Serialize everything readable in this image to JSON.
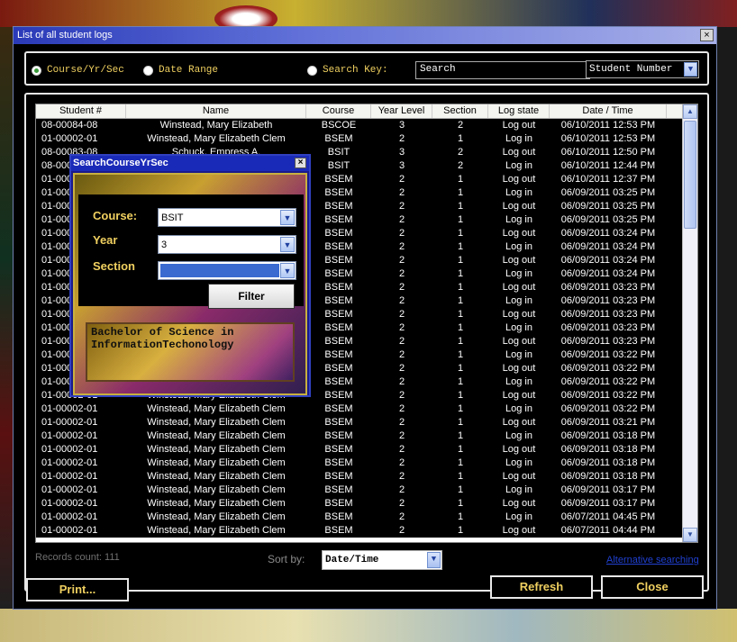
{
  "window": {
    "title": "List of all student logs",
    "close_glyph": "×"
  },
  "filter": {
    "radio_course": "Course/Yr/Sec",
    "radio_date": "Date Range",
    "radio_search": "Search Key:",
    "search_value": "Search",
    "search_field": "Student Number"
  },
  "grid": {
    "columns": [
      "Student #",
      "Name",
      "Course",
      "Year Level",
      "Section",
      "Log state",
      "Date / Time"
    ],
    "rows": [
      [
        "08-00084-08",
        "Winstead, Mary Elizabeth",
        "BSCOE",
        "3",
        "2",
        "Log out",
        "06/10/2011 12:53 PM"
      ],
      [
        "01-00002-01",
        "Winstead, Mary Elizabeth Clem",
        "BSEM",
        "2",
        "1",
        "Log in",
        "06/10/2011 12:53 PM"
      ],
      [
        "08-00083-08",
        "Schuck, Empress A.",
        "BSIT",
        "3",
        "2",
        "Log out",
        "06/10/2011 12:50 PM"
      ],
      [
        "08-00083-08",
        "Schuck, Empress A.",
        "BSIT",
        "3",
        "2",
        "Log in",
        "06/10/2011 12:44 PM"
      ],
      [
        "01-00002-01",
        "Winstead, Mary Elizabeth Clem",
        "BSEM",
        "2",
        "1",
        "Log out",
        "06/10/2011 12:37 PM"
      ],
      [
        "01-00002-01",
        "Winstead, Mary Elizabeth Clem",
        "BSEM",
        "2",
        "1",
        "Log in",
        "06/09/2011 03:25 PM"
      ],
      [
        "01-00002-01",
        "Winstead, Mary Elizabeth Clem",
        "BSEM",
        "2",
        "1",
        "Log out",
        "06/09/2011 03:25 PM"
      ],
      [
        "01-00002-01",
        "Winstead, Mary Elizabeth Clem",
        "BSEM",
        "2",
        "1",
        "Log in",
        "06/09/2011 03:25 PM"
      ],
      [
        "01-00002-01",
        "Winstead, Mary Elizabeth Clem",
        "BSEM",
        "2",
        "1",
        "Log out",
        "06/09/2011 03:24 PM"
      ],
      [
        "01-00002-01",
        "Winstead, Mary Elizabeth Clem",
        "BSEM",
        "2",
        "1",
        "Log in",
        "06/09/2011 03:24 PM"
      ],
      [
        "01-00002-01",
        "Winstead, Mary Elizabeth Clem",
        "BSEM",
        "2",
        "1",
        "Log out",
        "06/09/2011 03:24 PM"
      ],
      [
        "01-00002-01",
        "Winstead, Mary Elizabeth Clem",
        "BSEM",
        "2",
        "1",
        "Log in",
        "06/09/2011 03:24 PM"
      ],
      [
        "01-00002-01",
        "Winstead, Mary Elizabeth Clem",
        "BSEM",
        "2",
        "1",
        "Log out",
        "06/09/2011 03:23 PM"
      ],
      [
        "01-00002-01",
        "Winstead, Mary Elizabeth Clem",
        "BSEM",
        "2",
        "1",
        "Log in",
        "06/09/2011 03:23 PM"
      ],
      [
        "01-00002-01",
        "Winstead, Mary Elizabeth Clem",
        "BSEM",
        "2",
        "1",
        "Log out",
        "06/09/2011 03:23 PM"
      ],
      [
        "01-00002-01",
        "Winstead, Mary Elizabeth Clem",
        "BSEM",
        "2",
        "1",
        "Log in",
        "06/09/2011 03:23 PM"
      ],
      [
        "01-00002-01",
        "Winstead, Mary Elizabeth Clem",
        "BSEM",
        "2",
        "1",
        "Log out",
        "06/09/2011 03:23 PM"
      ],
      [
        "01-00002-01",
        "Winstead, Mary Elizabeth Clem",
        "BSEM",
        "2",
        "1",
        "Log in",
        "06/09/2011 03:22 PM"
      ],
      [
        "01-00002-01",
        "Winstead, Mary Elizabeth Clem",
        "BSEM",
        "2",
        "1",
        "Log out",
        "06/09/2011 03:22 PM"
      ],
      [
        "01-00002-01",
        "Winstead, Mary Elizabeth Clem",
        "BSEM",
        "2",
        "1",
        "Log in",
        "06/09/2011 03:22 PM"
      ],
      [
        "01-00002-01",
        "Winstead, Mary Elizabeth Clem",
        "BSEM",
        "2",
        "1",
        "Log out",
        "06/09/2011 03:22 PM"
      ],
      [
        "01-00002-01",
        "Winstead, Mary Elizabeth Clem",
        "BSEM",
        "2",
        "1",
        "Log in",
        "06/09/2011 03:22 PM"
      ],
      [
        "01-00002-01",
        "Winstead, Mary Elizabeth Clem",
        "BSEM",
        "2",
        "1",
        "Log out",
        "06/09/2011 03:21 PM"
      ],
      [
        "01-00002-01",
        "Winstead, Mary Elizabeth Clem",
        "BSEM",
        "2",
        "1",
        "Log in",
        "06/09/2011 03:18 PM"
      ],
      [
        "01-00002-01",
        "Winstead, Mary Elizabeth Clem",
        "BSEM",
        "2",
        "1",
        "Log out",
        "06/09/2011 03:18 PM"
      ],
      [
        "01-00002-01",
        "Winstead, Mary Elizabeth Clem",
        "BSEM",
        "2",
        "1",
        "Log in",
        "06/09/2011 03:18 PM"
      ],
      [
        "01-00002-01",
        "Winstead, Mary Elizabeth Clem",
        "BSEM",
        "2",
        "1",
        "Log out",
        "06/09/2011 03:18 PM"
      ],
      [
        "01-00002-01",
        "Winstead, Mary Elizabeth Clem",
        "BSEM",
        "2",
        "1",
        "Log in",
        "06/09/2011 03:17 PM"
      ],
      [
        "01-00002-01",
        "Winstead, Mary Elizabeth Clem",
        "BSEM",
        "2",
        "1",
        "Log out",
        "06/09/2011 03:17 PM"
      ],
      [
        "01-00002-01",
        "Winstead, Mary Elizabeth Clem",
        "BSEM",
        "2",
        "1",
        "Log in",
        "06/07/2011 04:45 PM"
      ],
      [
        "01-00002-01",
        "Winstead, Mary Elizabeth Clem",
        "BSEM",
        "2",
        "1",
        "Log out",
        "06/07/2011 04:44 PM"
      ]
    ]
  },
  "footer": {
    "records_count": "Records count: 111",
    "sort_label": "Sort by:",
    "sort_value": "Date/Time",
    "alt_link": "Alternative searching"
  },
  "buttons": {
    "print": "Print...",
    "refresh": "Refresh",
    "close": "Close"
  },
  "dialog": {
    "title": "SearchCourseYrSec",
    "close_glyph": "×",
    "course_label": "Course:",
    "course_value": "BSIT",
    "year_label": "Year",
    "year_value": "3",
    "section_label": "Section",
    "section_value": "",
    "filter_button": "Filter",
    "description": "Bachelor of Science in InformationTechonology"
  }
}
